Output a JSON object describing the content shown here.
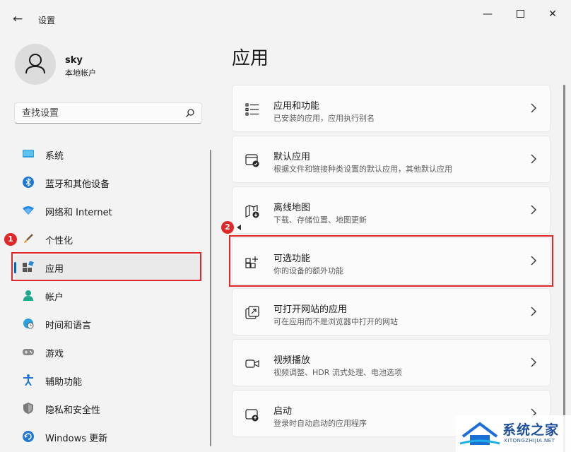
{
  "window": {
    "title": "设置",
    "back_icon": "arrow-left-icon",
    "minimize_icon": "minimize-icon",
    "maximize_icon": "maximize-icon",
    "close_icon": "close-icon"
  },
  "profile": {
    "name": "sky",
    "account_type": "本地帐户",
    "avatar_icon": "person-icon"
  },
  "search": {
    "placeholder": "查找设置",
    "icon": "search-icon"
  },
  "sidebar": {
    "items": [
      {
        "label": "系统",
        "icon": "monitor-icon",
        "active": false
      },
      {
        "label": "蓝牙和其他设备",
        "icon": "bluetooth-icon",
        "active": false
      },
      {
        "label": "网络和 Internet",
        "icon": "wifi-icon",
        "active": false
      },
      {
        "label": "个性化",
        "icon": "brush-icon",
        "active": false
      },
      {
        "label": "应用",
        "icon": "apps-icon",
        "active": true
      },
      {
        "label": "帐户",
        "icon": "account-icon",
        "active": false
      },
      {
        "label": "时间和语言",
        "icon": "globe-clock-icon",
        "active": false
      },
      {
        "label": "游戏",
        "icon": "gamepad-icon",
        "active": false
      },
      {
        "label": "辅助功能",
        "icon": "accessibility-icon",
        "active": false
      },
      {
        "label": "隐私和安全性",
        "icon": "shield-icon",
        "active": false
      },
      {
        "label": "Windows 更新",
        "icon": "update-icon",
        "active": false
      }
    ]
  },
  "main": {
    "title": "应用",
    "cards": [
      {
        "title": "应用和功能",
        "subtitle": "已安装的应用，应用执行别名",
        "icon": "list-icon"
      },
      {
        "title": "默认应用",
        "subtitle": "根据文件和链接种类设置的默认应用，其他默认应用",
        "icon": "default-app-icon"
      },
      {
        "title": "离线地图",
        "subtitle": "下载、存储位置、地图更新",
        "icon": "map-download-icon"
      },
      {
        "title": "可选功能",
        "subtitle": "你的设备的额外功能",
        "icon": "add-grid-icon"
      },
      {
        "title": "可打开网站的应用",
        "subtitle": "可在应用而不是浏览器中打开的网站",
        "icon": "open-link-icon"
      },
      {
        "title": "视频播放",
        "subtitle": "视频调整、HDR 流式处理、电池选项",
        "icon": "video-icon"
      },
      {
        "title": "启动",
        "subtitle": "登录时自动启动的应用程序",
        "icon": "startup-icon"
      }
    ]
  },
  "annotations": {
    "badge_1": "1",
    "badge_2": "2",
    "color": "#e0282b"
  },
  "watermark": {
    "text": "系统之家",
    "sub": "XITONGZHIJIA.NET"
  },
  "colors": {
    "accent": "#0067c0",
    "highlight": "#e0282b",
    "background": "#f3f3f3"
  }
}
